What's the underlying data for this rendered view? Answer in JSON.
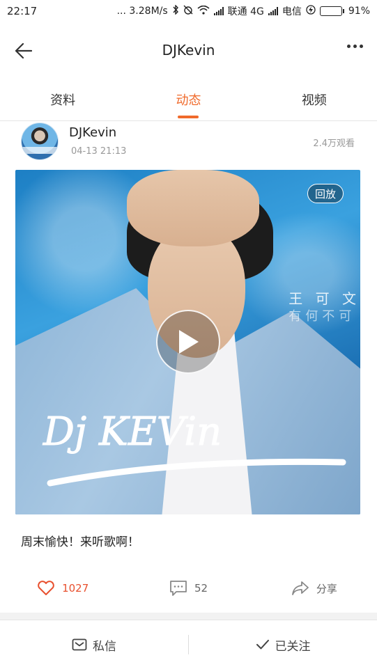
{
  "status_bar": {
    "time": "22:17",
    "speed": "... 3.28M/s",
    "carrier1": "联通 4G",
    "carrier2": "电信",
    "battery": "91%",
    "battery_level": 0.91
  },
  "header": {
    "title": "DJKevin",
    "back_icon": "arrow-left-icon",
    "more_icon": "more-dots-icon"
  },
  "tabs": [
    {
      "label": "资料",
      "active": false
    },
    {
      "label": "动态",
      "active": true
    },
    {
      "label": "视频",
      "active": false
    }
  ],
  "post": {
    "username": "DJKevin",
    "time": "04-13 21:13",
    "views": "2.4万观看",
    "replay_label": "回放",
    "video_overlay_text_1": "王 可 文",
    "video_overlay_text_2": "有何不可",
    "logo_text": "Dj KEVin",
    "caption": "周末愉快！来听歌啊！"
  },
  "actions": {
    "likes": "1027",
    "comments": "52",
    "share_label": "分享"
  },
  "bottom_bar": {
    "message_label": "私信",
    "follow_label": "已关注"
  },
  "colors": {
    "accent": "#f06a2b",
    "like": "#e8502e"
  }
}
